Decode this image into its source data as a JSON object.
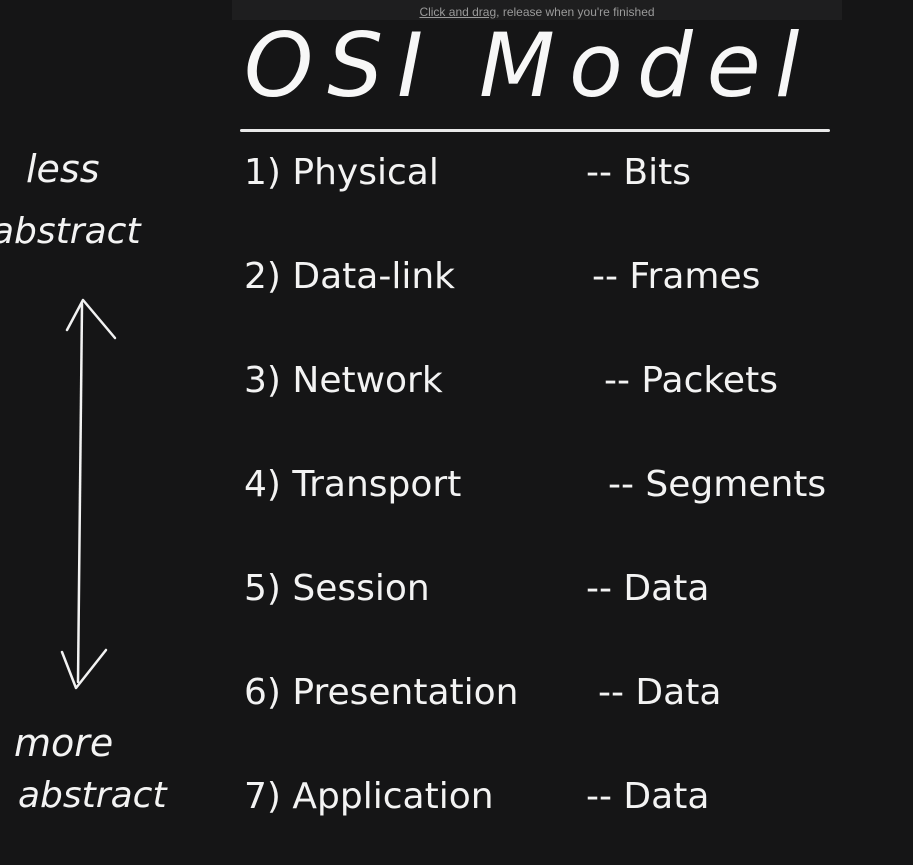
{
  "screen_hint": {
    "part1": "Click and drag",
    "part2": ", release when you're finished"
  },
  "title": "OSI Model",
  "layers": [
    {
      "name": "1) Physical",
      "unit": "-- Bits"
    },
    {
      "name": "2) Data-link",
      "unit": "-- Frames"
    },
    {
      "name": "3) Network",
      "unit": "-- Packets"
    },
    {
      "name": "4) Transport",
      "unit": "-- Segments"
    },
    {
      "name": "5) Session",
      "unit": "-- Data"
    },
    {
      "name": "6) Presentation",
      "unit": "-- Data"
    },
    {
      "name": "7) Application",
      "unit": "-- Data"
    }
  ],
  "axis": {
    "top_line1": "less",
    "top_line2": "abstract",
    "bottom_line1": "more",
    "bottom_line2": "abstract"
  },
  "colors": {
    "background": "#151516",
    "ink": "#f2f2f2",
    "hint": "#9a9a9a"
  }
}
